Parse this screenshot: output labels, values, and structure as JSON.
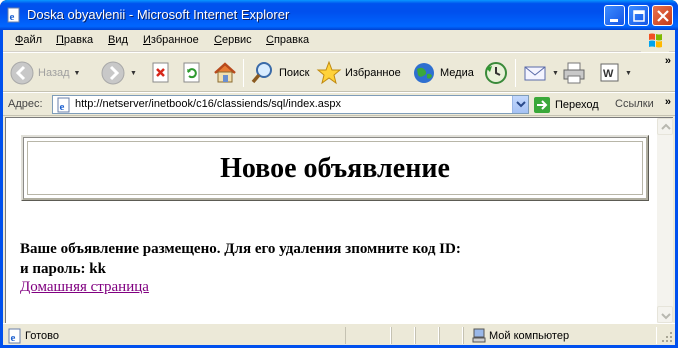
{
  "window": {
    "title": "Doska obyavlenii - Microsoft Internet Explorer"
  },
  "menu": {
    "items": [
      {
        "accel": "Ф",
        "rest": "айл"
      },
      {
        "accel": "П",
        "rest": "равка"
      },
      {
        "accel": "В",
        "rest": "ид"
      },
      {
        "accel": "И",
        "rest": "збранное"
      },
      {
        "accel": "С",
        "rest": "ервис"
      },
      {
        "accel": "С",
        "rest": "правка"
      }
    ]
  },
  "toolbar": {
    "back_label": "Назад",
    "search_label": "Поиск",
    "favorites_label": "Избранное",
    "media_label": "Медиа"
  },
  "address": {
    "label": "Адрес:",
    "url": "http://netserver/inetbook/c16/classiends/sql/index.aspx",
    "go_label": "Переход",
    "links_label": "Ссылки"
  },
  "page": {
    "heading": "Новое объявление",
    "message_line1": "Ваше объявление размещено. Для его удаления зпомните код ID:",
    "message_line2": "и пароль: kk",
    "home_link": "Домашняя страница"
  },
  "status": {
    "text": "Готово",
    "zone": "Мой компьютер"
  },
  "colors": {
    "titlebar": "#0054e3",
    "chrome": "#ece9d8",
    "visited_link": "#800080"
  }
}
